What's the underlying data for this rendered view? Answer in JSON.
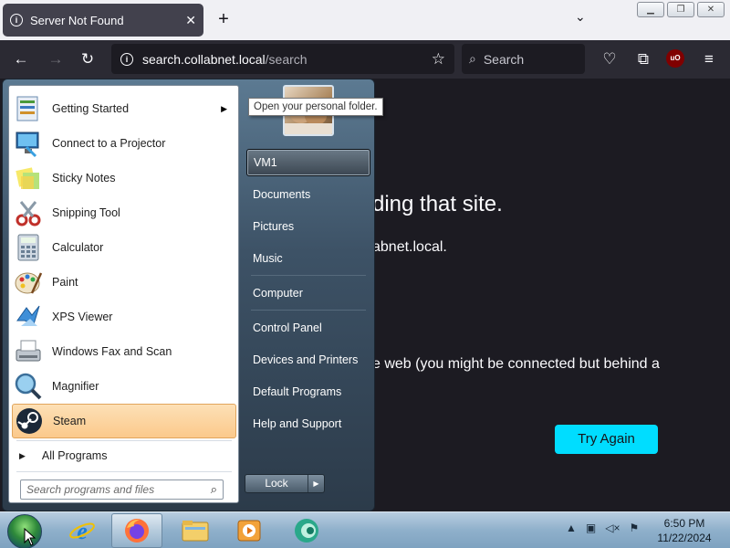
{
  "browser": {
    "tab_title": "Server Not Found",
    "url_host": "search.collabnet.local",
    "url_path": "/search",
    "search_placeholder": "Search"
  },
  "page": {
    "title_fragment": "ding that site.",
    "line1_fragment": "abnet.local.",
    "line2_fragment": "e web (you might be connected but behind a",
    "try_again": "Try Again"
  },
  "startmenu": {
    "programs": [
      {
        "label": "Getting Started",
        "icon": "getting-started-icon",
        "has_submenu": true
      },
      {
        "label": "Connect to a Projector",
        "icon": "projector-icon"
      },
      {
        "label": "Sticky Notes",
        "icon": "sticky-notes-icon"
      },
      {
        "label": "Snipping Tool",
        "icon": "snipping-tool-icon"
      },
      {
        "label": "Calculator",
        "icon": "calculator-icon"
      },
      {
        "label": "Paint",
        "icon": "paint-icon"
      },
      {
        "label": "XPS Viewer",
        "icon": "xps-viewer-icon"
      },
      {
        "label": "Windows Fax and Scan",
        "icon": "fax-scan-icon"
      },
      {
        "label": "Magnifier",
        "icon": "magnifier-icon"
      },
      {
        "label": "Steam",
        "icon": "steam-icon"
      }
    ],
    "all_programs": "All Programs",
    "search_placeholder": "Search programs and files",
    "right_items": [
      "VM1",
      "Documents",
      "Pictures",
      "Music",
      "Computer",
      "Control Panel",
      "Devices and Printers",
      "Default Programs",
      "Help and Support"
    ],
    "tooltip": "Open your personal folder.",
    "lock_label": "Lock"
  },
  "taskbar": {
    "time": "6:50 PM",
    "date": "11/22/2024",
    "items": [
      "internet-explorer-icon",
      "firefox-icon",
      "file-explorer-icon",
      "media-player-icon",
      "app-icon"
    ]
  },
  "colors": {
    "accent": "#00ddff",
    "highlight": "#fbc98b"
  }
}
